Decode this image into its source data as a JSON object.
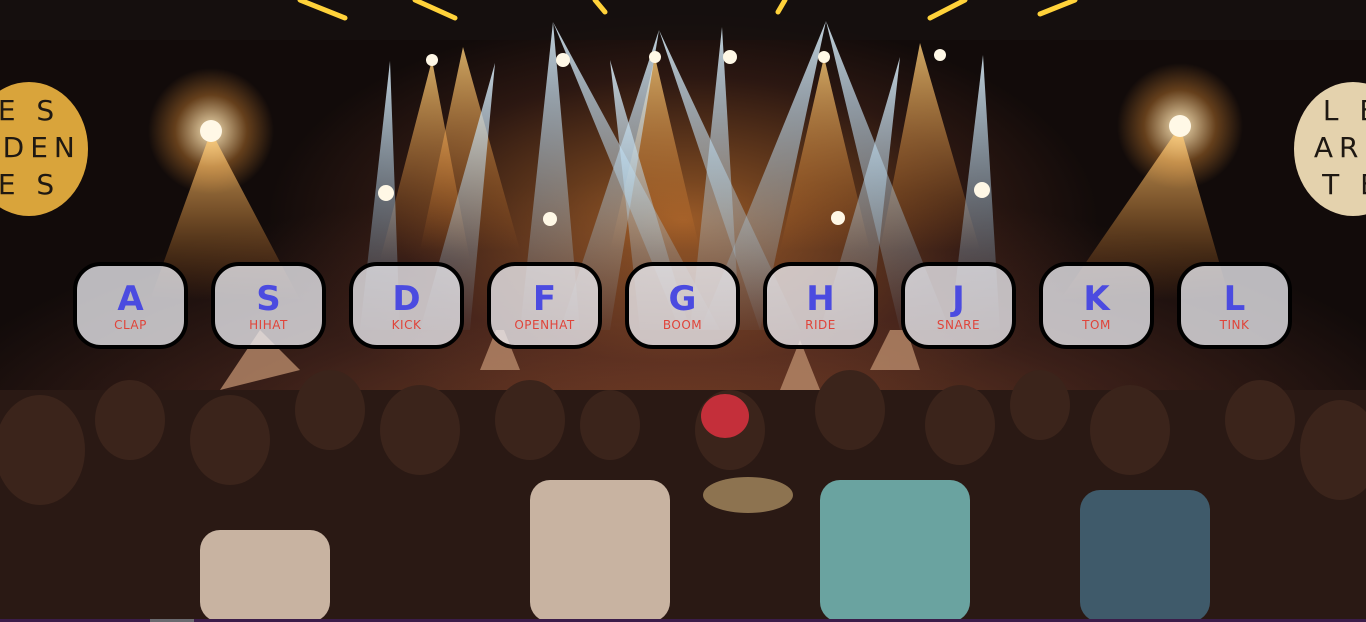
{
  "banners": {
    "left": [
      "E S",
      "RDEN",
      "E S"
    ],
    "right": [
      "L E",
      "ARD",
      "T E"
    ]
  },
  "keys": [
    {
      "letter": "A",
      "sound": "CLAP"
    },
    {
      "letter": "S",
      "sound": "HIHAT"
    },
    {
      "letter": "D",
      "sound": "KICK"
    },
    {
      "letter": "F",
      "sound": "OPENHAT"
    },
    {
      "letter": "G",
      "sound": "BOOM"
    },
    {
      "letter": "H",
      "sound": "RIDE"
    },
    {
      "letter": "J",
      "sound": "SNARE"
    },
    {
      "letter": "K",
      "sound": "TOM"
    },
    {
      "letter": "L",
      "sound": "TINK"
    }
  ],
  "colors": {
    "key_letter": "#4b4be0",
    "key_sound": "#e0443a",
    "key_border": "#000000",
    "banner_left": "#d9a43b",
    "banner_right": "#e4d2ad"
  }
}
